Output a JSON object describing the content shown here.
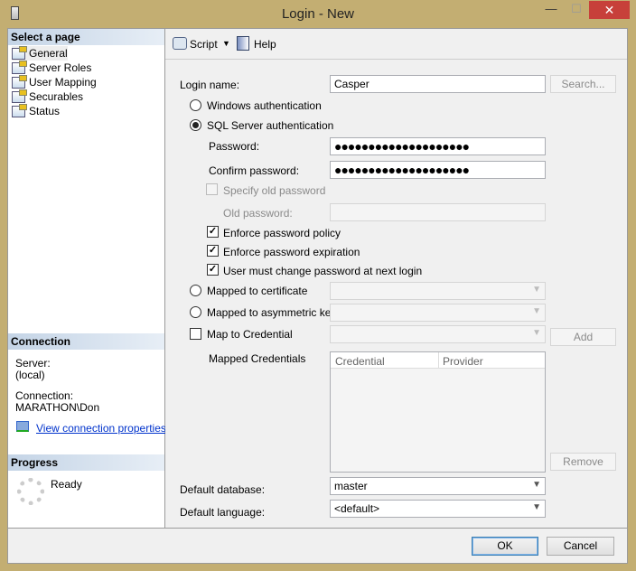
{
  "window": {
    "title": "Login - New",
    "minimize": "—",
    "maximize": "☐",
    "close": "✕"
  },
  "left": {
    "select_header": "Select a page",
    "pages": [
      {
        "label": "General"
      },
      {
        "label": "Server Roles"
      },
      {
        "label": "User Mapping"
      },
      {
        "label": "Securables"
      },
      {
        "label": "Status"
      }
    ],
    "connection_header": "Connection",
    "server_label": "Server:",
    "server_value": "(local)",
    "connection_label": "Connection:",
    "connection_value": "MARATHON\\Don",
    "view_link": "View connection properties",
    "progress_header": "Progress",
    "progress_status": "Ready"
  },
  "toolbar": {
    "script": "Script",
    "help": "Help"
  },
  "form": {
    "login_name_label": "Login name:",
    "login_name_value": "Casper",
    "search": "Search...",
    "windows_auth": "Windows authentication",
    "sql_auth": "SQL Server authentication",
    "password_label": "Password:",
    "password_value": "●●●●●●●●●●●●●●●●●●●●",
    "confirm_label": "Confirm password:",
    "confirm_value": "●●●●●●●●●●●●●●●●●●●●",
    "specify_old": "Specify old password",
    "old_password_label": "Old password:",
    "enforce_policy": "Enforce password policy",
    "enforce_expiration": "Enforce password expiration",
    "must_change": "User must change password at next login",
    "mapped_cert": "Mapped to certificate",
    "mapped_asym": "Mapped to asymmetric key",
    "map_credential": "Map to Credential",
    "add": "Add",
    "mapped_credentials_label": "Mapped Credentials",
    "grid_columns": [
      "Credential",
      "Provider"
    ],
    "remove": "Remove",
    "default_db_label": "Default database:",
    "default_db_value": "master",
    "default_lang_label": "Default language:",
    "default_lang_value": "<default>"
  },
  "buttons": {
    "ok": "OK",
    "cancel": "Cancel"
  }
}
